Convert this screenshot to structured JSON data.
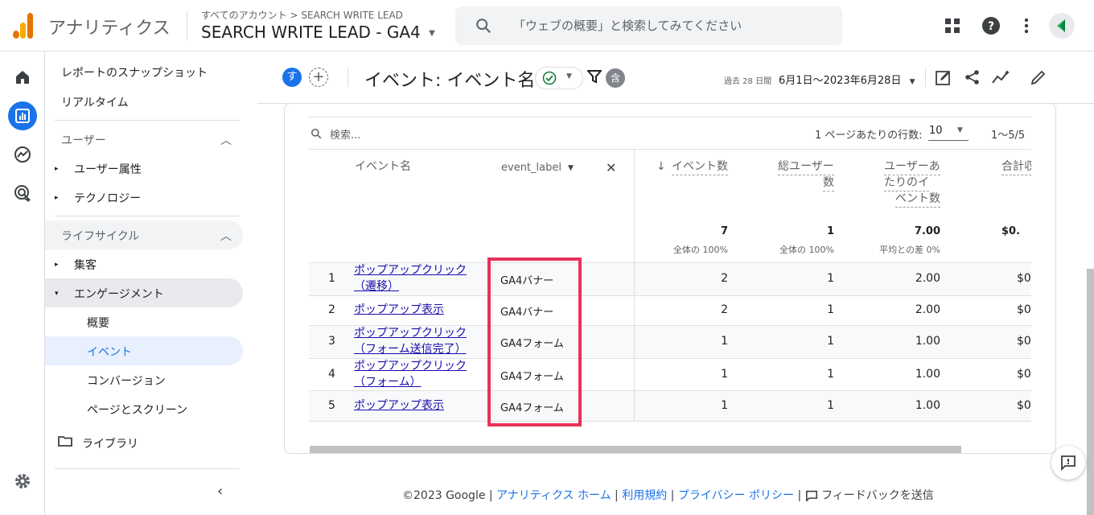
{
  "header": {
    "app_name": "アナリティクス",
    "breadcrumb": "すべてのアカウント > SEARCH WRITE LEAD",
    "property": "SEARCH WRITE LEAD - GA4",
    "search_placeholder": "「ウェブの概要」と検索してみてください"
  },
  "nav": {
    "snapshot": "レポートのスナップショット",
    "realtime": "リアルタイム",
    "user_section": "ユーザー",
    "user_attr": "ユーザー属性",
    "tech": "テクノロジー",
    "lifecycle": "ライフサイクル",
    "acquisition": "集客",
    "engagement": "エンゲージメント",
    "overview": "概要",
    "events": "イベント",
    "conversions": "コンバージョン",
    "pages": "ページとスクリーン",
    "library": "ライブラリ"
  },
  "report": {
    "avatar_letter": "す",
    "title": "イベント: イベント名",
    "compare_badge": "含",
    "date_prefix": "過去 28 日間",
    "date_range": "6月1日～2023年6月28日"
  },
  "table": {
    "search_placeholder": "検索...",
    "rows_per_page_label": "1 ページあたりの行数:",
    "rows_per_page": "10",
    "pagination": "1～5/5",
    "col_event_name": "イベント名",
    "col_dimension2": "event_label",
    "col_events": "イベント数",
    "col_users_1": "総ユーザー",
    "col_users_2": "数",
    "col_per_user_1": "ユーザーあ",
    "col_per_user_2": "たりのイ",
    "col_per_user_3": "ベント数",
    "col_revenue": "合計収",
    "total_events": "7",
    "total_events_sub": "全体の 100%",
    "total_users": "1",
    "total_users_sub": "全体の 100%",
    "total_per_user": "7.00",
    "total_per_user_sub": "平均との差 0%",
    "total_revenue": "$0.",
    "rows": [
      {
        "idx": "1",
        "name1": "ポップアップクリック",
        "name2": "（遷移）",
        "label": "GA4バナー",
        "events": "2",
        "users": "1",
        "per_user": "2.00",
        "revenue": "$0"
      },
      {
        "idx": "2",
        "name1": "ポップアップ表示",
        "name2": "",
        "label": "GA4バナー",
        "events": "2",
        "users": "1",
        "per_user": "2.00",
        "revenue": "$0"
      },
      {
        "idx": "3",
        "name1": "ポップアップクリック",
        "name2": "（フォーム送信完了）",
        "label": "GA4フォーム",
        "events": "1",
        "users": "1",
        "per_user": "1.00",
        "revenue": "$0"
      },
      {
        "idx": "4",
        "name1": "ポップアップクリック",
        "name2": "（フォーム）",
        "label": "GA4フォーム",
        "events": "1",
        "users": "1",
        "per_user": "1.00",
        "revenue": "$0"
      },
      {
        "idx": "5",
        "name1": "ポップアップ表示",
        "name2": "",
        "label": "GA4フォーム",
        "events": "1",
        "users": "1",
        "per_user": "1.00",
        "revenue": "$0"
      }
    ]
  },
  "footer": {
    "copyright": "©2023 Google",
    "home": "アナリティクス ホーム",
    "terms": "利用規約",
    "privacy": "プライバシー ポリシー",
    "feedback": "フィードバックを送信"
  },
  "colors": {
    "accent_blue": "#1a73e8",
    "highlight_red": "#e8325a",
    "nav_selected": "#e8f0fe",
    "logo_orange": "#f9ab00",
    "logo_dark_orange": "#e37400"
  }
}
